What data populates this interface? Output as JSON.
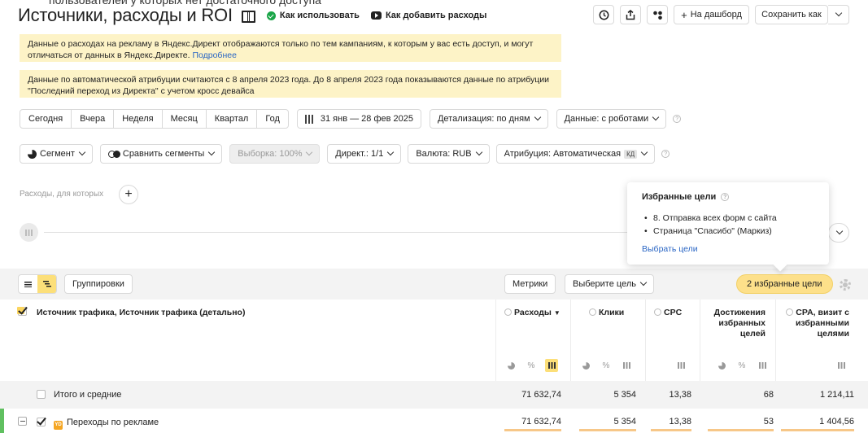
{
  "header": {
    "cutoff_text": "пользователей у которых нет достаточного доступа",
    "title": "Источники, расходы и ROI",
    "how_to_use": "Как использовать",
    "how_to_add_expenses": "Как добавить расходы",
    "to_dashboard": "На дашборд",
    "save_as": "Сохранить как"
  },
  "notices": {
    "first": "Данные о расходах на рекламу в Яндекс.Директ отображаются только по тем кампаниям, к которым у вас есть доступ, и могут отличаться от данных в Яндекс.Директе. ",
    "first_link": "Подробнее",
    "second": "Данные по автоматической атрибуции считаются с 8 апреля 2023 года. До 8 апреля 2023 года показываются данные по атрибуции \"Последний переход из Директа\" с учетом кросс девайса"
  },
  "period": {
    "buttons": [
      "Сегодня",
      "Вчера",
      "Неделя",
      "Месяц",
      "Квартал",
      "Год"
    ],
    "date_range": "31 янв — 28 фев 2025",
    "detail": "Детализация: по дням",
    "data": "Данные: с роботами"
  },
  "filters": {
    "segment": "Сегмент",
    "compare": "Сравнить сегменты",
    "sample": "Выборка: 100%",
    "direct": "Директ.: 1/1",
    "currency": "Валюта: RUB",
    "attribution": "Атрибуция: Автоматическая",
    "attribution_badge": "КД"
  },
  "expenses_label": "Расходы, для которых",
  "popup": {
    "title": "Избранные цели",
    "goals": [
      "8. Отправка всех форм с сайта",
      "Страница \"Спасибо\" (Маркиз)"
    ],
    "choose_link": "Выбрать цели"
  },
  "table_bar": {
    "groupings": "Группировки",
    "metrics": "Метрики",
    "choose_goal": "Выберите цель",
    "fav_goals": "2 избранные цели"
  },
  "columns": {
    "dimension": "Источник трафика, Источник трафика (детально)",
    "expenses": "Расходы",
    "clicks": "Клики",
    "cpc": "CPC",
    "achievements": "Достижения избранных целей",
    "cpa": "CPA, визит с избранными целями"
  },
  "rows": [
    {
      "label": "Итого и средние",
      "expenses": "71 632,74",
      "clicks": "5 354",
      "cpc": "13,38",
      "achievements": "68",
      "cpa": "1 214,11"
    },
    {
      "label": "Переходы по рекламе",
      "badge": "YD",
      "expenses": "71 632,74",
      "clicks": "5 354",
      "cpc": "13,38",
      "achievements": "53",
      "cpa": "1 404,56"
    }
  ]
}
